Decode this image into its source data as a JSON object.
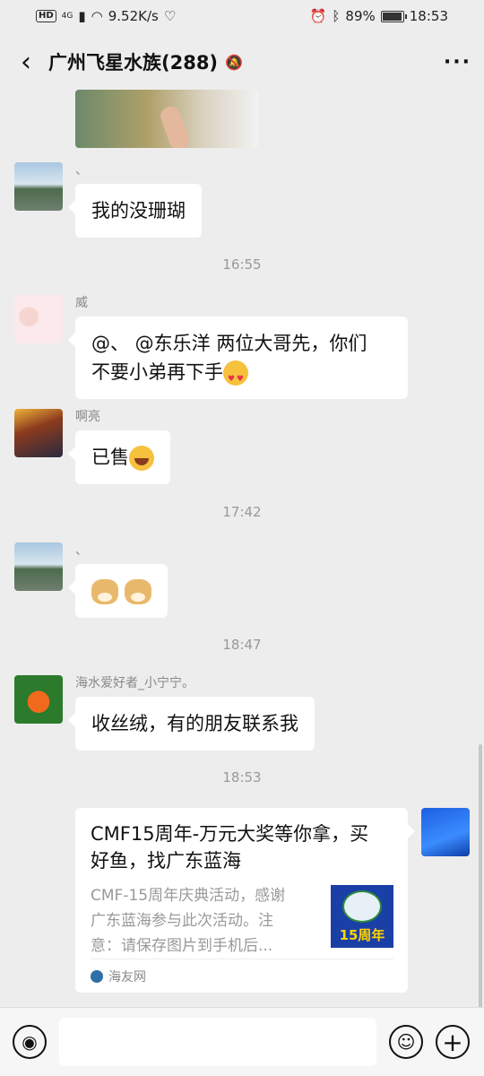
{
  "status": {
    "signal": "4G",
    "network_speed": "9.52K/s",
    "battery": "89%",
    "time": "18:53"
  },
  "header": {
    "title": "广州飞星水族(288)"
  },
  "messages": [
    {
      "sender": "、",
      "text": "我的没珊瑚"
    },
    {
      "sender": "威",
      "line1": "@、 @东乐洋  两位大哥先，你们",
      "line2": "不要小弟再下手"
    },
    {
      "sender": "啊亮",
      "text": "已售"
    },
    {
      "sender": "、"
    },
    {
      "sender": "海水爱好者_小宁宁。",
      "text": "收丝绒，有的朋友联系我"
    }
  ],
  "timestamps": [
    "16:55",
    "17:42",
    "18:47",
    "18:53"
  ],
  "card": {
    "title_line1": "CMF15周年-万元大奖等你拿，买",
    "title_line2": "好鱼，找广东蓝海",
    "desc_line1": "CMF-15周年庆典活动，感谢",
    "desc_line2": "广东蓝海参与此次活动。注",
    "desc_line3": "意：请保存图片到手机后...",
    "thumb_text": "15周年",
    "source": "海友网"
  },
  "colors": {
    "chat_bg": "#ededed",
    "bubble": "#ffffff",
    "time_text": "#999999"
  }
}
